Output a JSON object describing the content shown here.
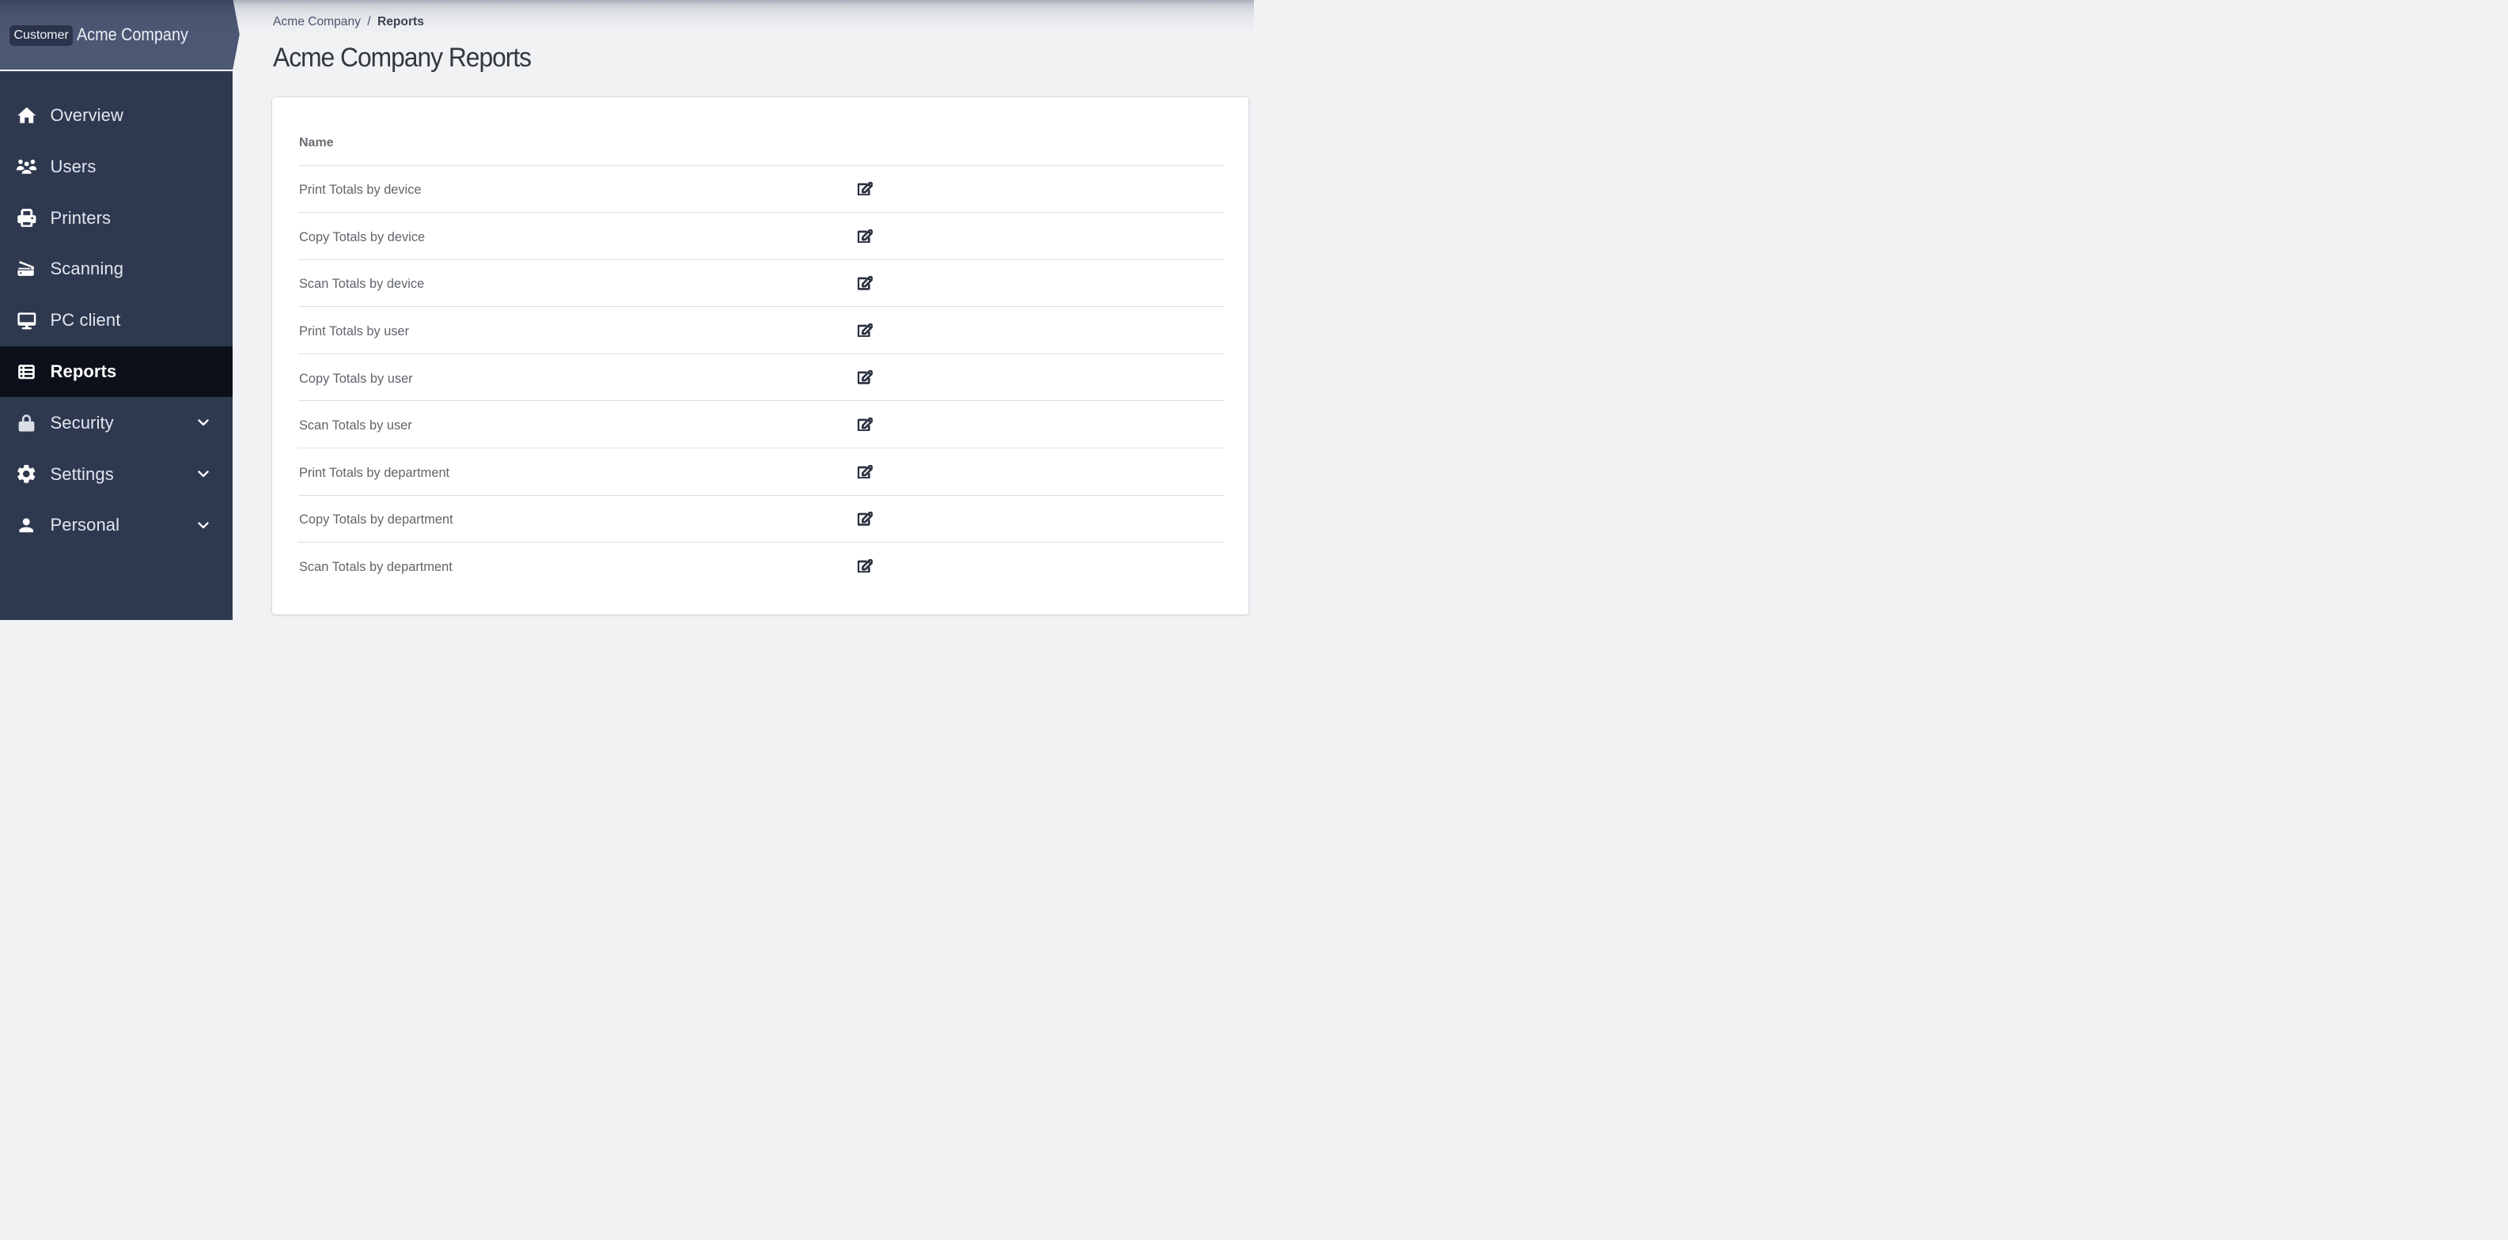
{
  "sidebar": {
    "customer_badge": "Customer",
    "customer_name": "Acme Company",
    "items": [
      {
        "label": "Overview",
        "icon": "home-icon",
        "active": false,
        "expandable": false
      },
      {
        "label": "Users",
        "icon": "users-icon",
        "active": false,
        "expandable": false
      },
      {
        "label": "Printers",
        "icon": "printer-icon",
        "active": false,
        "expandable": false
      },
      {
        "label": "Scanning",
        "icon": "scanner-icon",
        "active": false,
        "expandable": false
      },
      {
        "label": "PC client",
        "icon": "desktop-icon",
        "active": false,
        "expandable": false
      },
      {
        "label": "Reports",
        "icon": "table-list-icon",
        "active": true,
        "expandable": false
      },
      {
        "label": "Security",
        "icon": "lock-icon",
        "active": false,
        "expandable": true
      },
      {
        "label": "Settings",
        "icon": "gear-icon",
        "active": false,
        "expandable": true
      },
      {
        "label": "Personal",
        "icon": "person-icon",
        "active": false,
        "expandable": true
      }
    ]
  },
  "breadcrumb": {
    "parent": "Acme Company",
    "separator": "/",
    "current": "Reports"
  },
  "page": {
    "title": "Acme Company Reports"
  },
  "table": {
    "name_header": "Name",
    "row_action_icon": "edit-icon",
    "rows": [
      {
        "name": "Print Totals by device"
      },
      {
        "name": "Copy Totals by device"
      },
      {
        "name": "Scan Totals by device"
      },
      {
        "name": "Print Totals by user"
      },
      {
        "name": "Copy Totals by user"
      },
      {
        "name": "Scan Totals by user"
      },
      {
        "name": "Print Totals by department"
      },
      {
        "name": "Copy Totals by department"
      },
      {
        "name": "Scan Totals by department"
      }
    ]
  },
  "colors": {
    "sidebar_bg": "#2e3950",
    "sidebar_active_bg": "#0c101b",
    "sidebar_header_bg": "#4c5774",
    "customer_badge_bg": "#2a3349",
    "content_bg": "#f1f2f4",
    "card_bg": "#ffffff",
    "row_divider": "#dcdfe3",
    "nav_text": "#e2e6ee",
    "title_text": "#33383e",
    "table_text": "#60656b"
  }
}
